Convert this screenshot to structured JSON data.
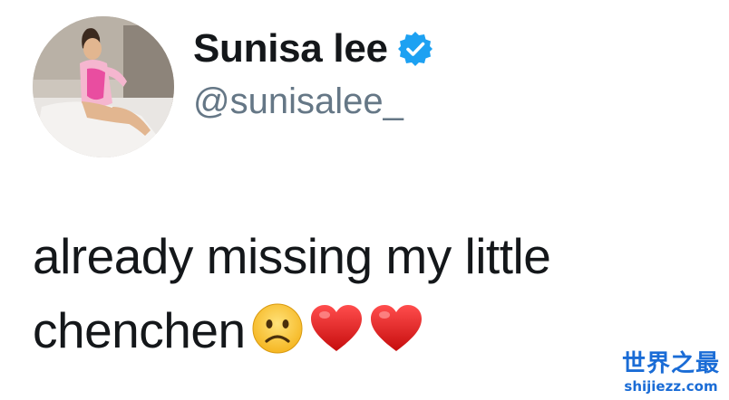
{
  "tweet": {
    "author": {
      "display_name": "Sunisa lee",
      "handle": "@sunisalee_",
      "verified": true,
      "verified_icon": "verified-badge-icon",
      "avatar_icon": "profile-avatar"
    },
    "text_lines": [
      "already missing my little",
      "chenchen"
    ],
    "emojis": [
      "frowning-face-emoji",
      "red-heart-emoji",
      "red-heart-emoji"
    ]
  },
  "watermark": {
    "title": "世界之最",
    "url": "shijiezz.com"
  },
  "colors": {
    "background": "#ffffff",
    "text": "#14171a",
    "handle": "#657786",
    "verified": "#1da1f2",
    "watermark": "#1a6cd6"
  }
}
